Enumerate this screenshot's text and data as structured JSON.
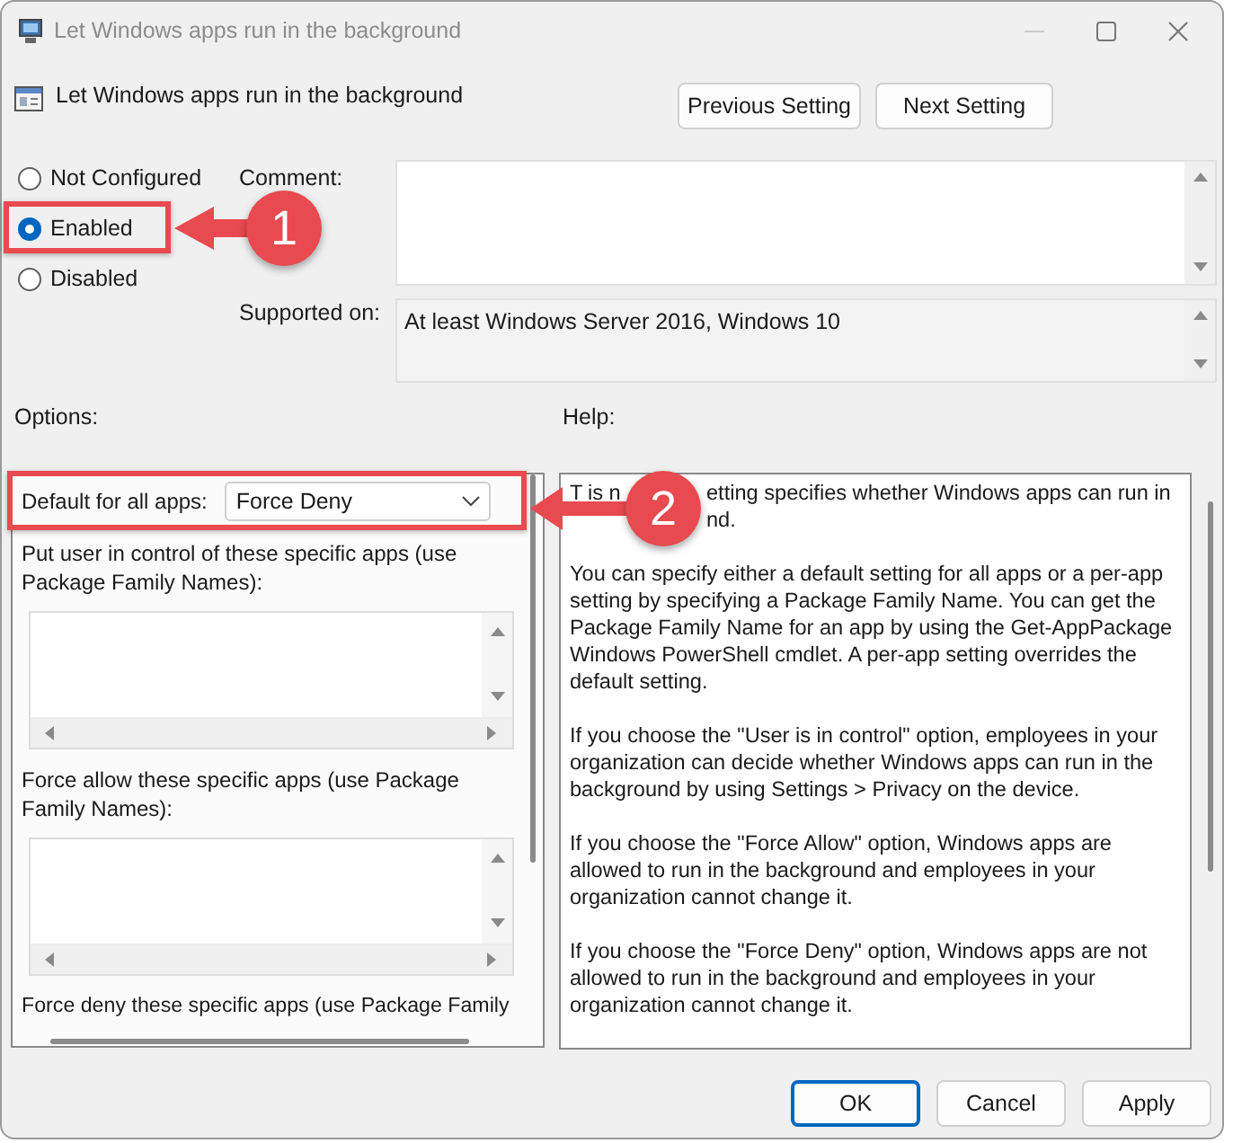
{
  "window": {
    "title": "Let Windows apps run in the background"
  },
  "header": {
    "title": "Let Windows apps run in the background"
  },
  "nav_buttons": [
    "Previous Setting",
    "Next Setting"
  ],
  "state_options": [
    {
      "label": "Not Configured",
      "selected": false
    },
    {
      "label": "Enabled",
      "selected": true
    },
    {
      "label": "Disabled",
      "selected": false
    }
  ],
  "comment": {
    "label": "Comment:"
  },
  "supported_on": {
    "label": "Supported on:",
    "value": "At least Windows Server 2016, Windows 10"
  },
  "options": {
    "label": "Options:",
    "default_label": "Default for all apps:",
    "default_value": "Force Deny",
    "lists": [
      {
        "label": "Put user in control of these specific apps (use Package Family Names):"
      },
      {
        "label": "Force allow these specific apps (use Package Family Names):"
      }
    ],
    "trailing_label": "Force deny these specific apps (use Package Family"
  },
  "help": {
    "label": "Help:",
    "covered_lines": [
      [
        "T",
        "is n",
        "etting specifies whether Windows apps can run in"
      ],
      [
        "nd."
      ]
    ],
    "paragraphs": [
      "You can specify either a default setting for all apps or a per-app setting by specifying a Package Family Name. You can get the Package Family Name for an app by using the Get-AppPackage Windows PowerShell cmdlet. A per-app setting overrides the default setting.",
      "If you choose the \"User is in control\" option, employees in your organization can decide whether Windows apps can run in the background by using Settings > Privacy on the device.",
      "If you choose the \"Force Allow\" option, Windows apps are allowed to run in the background and employees in your organization cannot change it.",
      "If you choose the \"Force Deny\" option, Windows apps are not allowed to run in the background and employees in your organization cannot change it."
    ]
  },
  "buttons": [
    {
      "label": "OK",
      "focused": true
    },
    {
      "label": "Cancel",
      "focused": false
    },
    {
      "label": "Apply",
      "focused": false
    }
  ],
  "callouts": [
    {
      "number": "1"
    },
    {
      "number": "2"
    }
  ]
}
